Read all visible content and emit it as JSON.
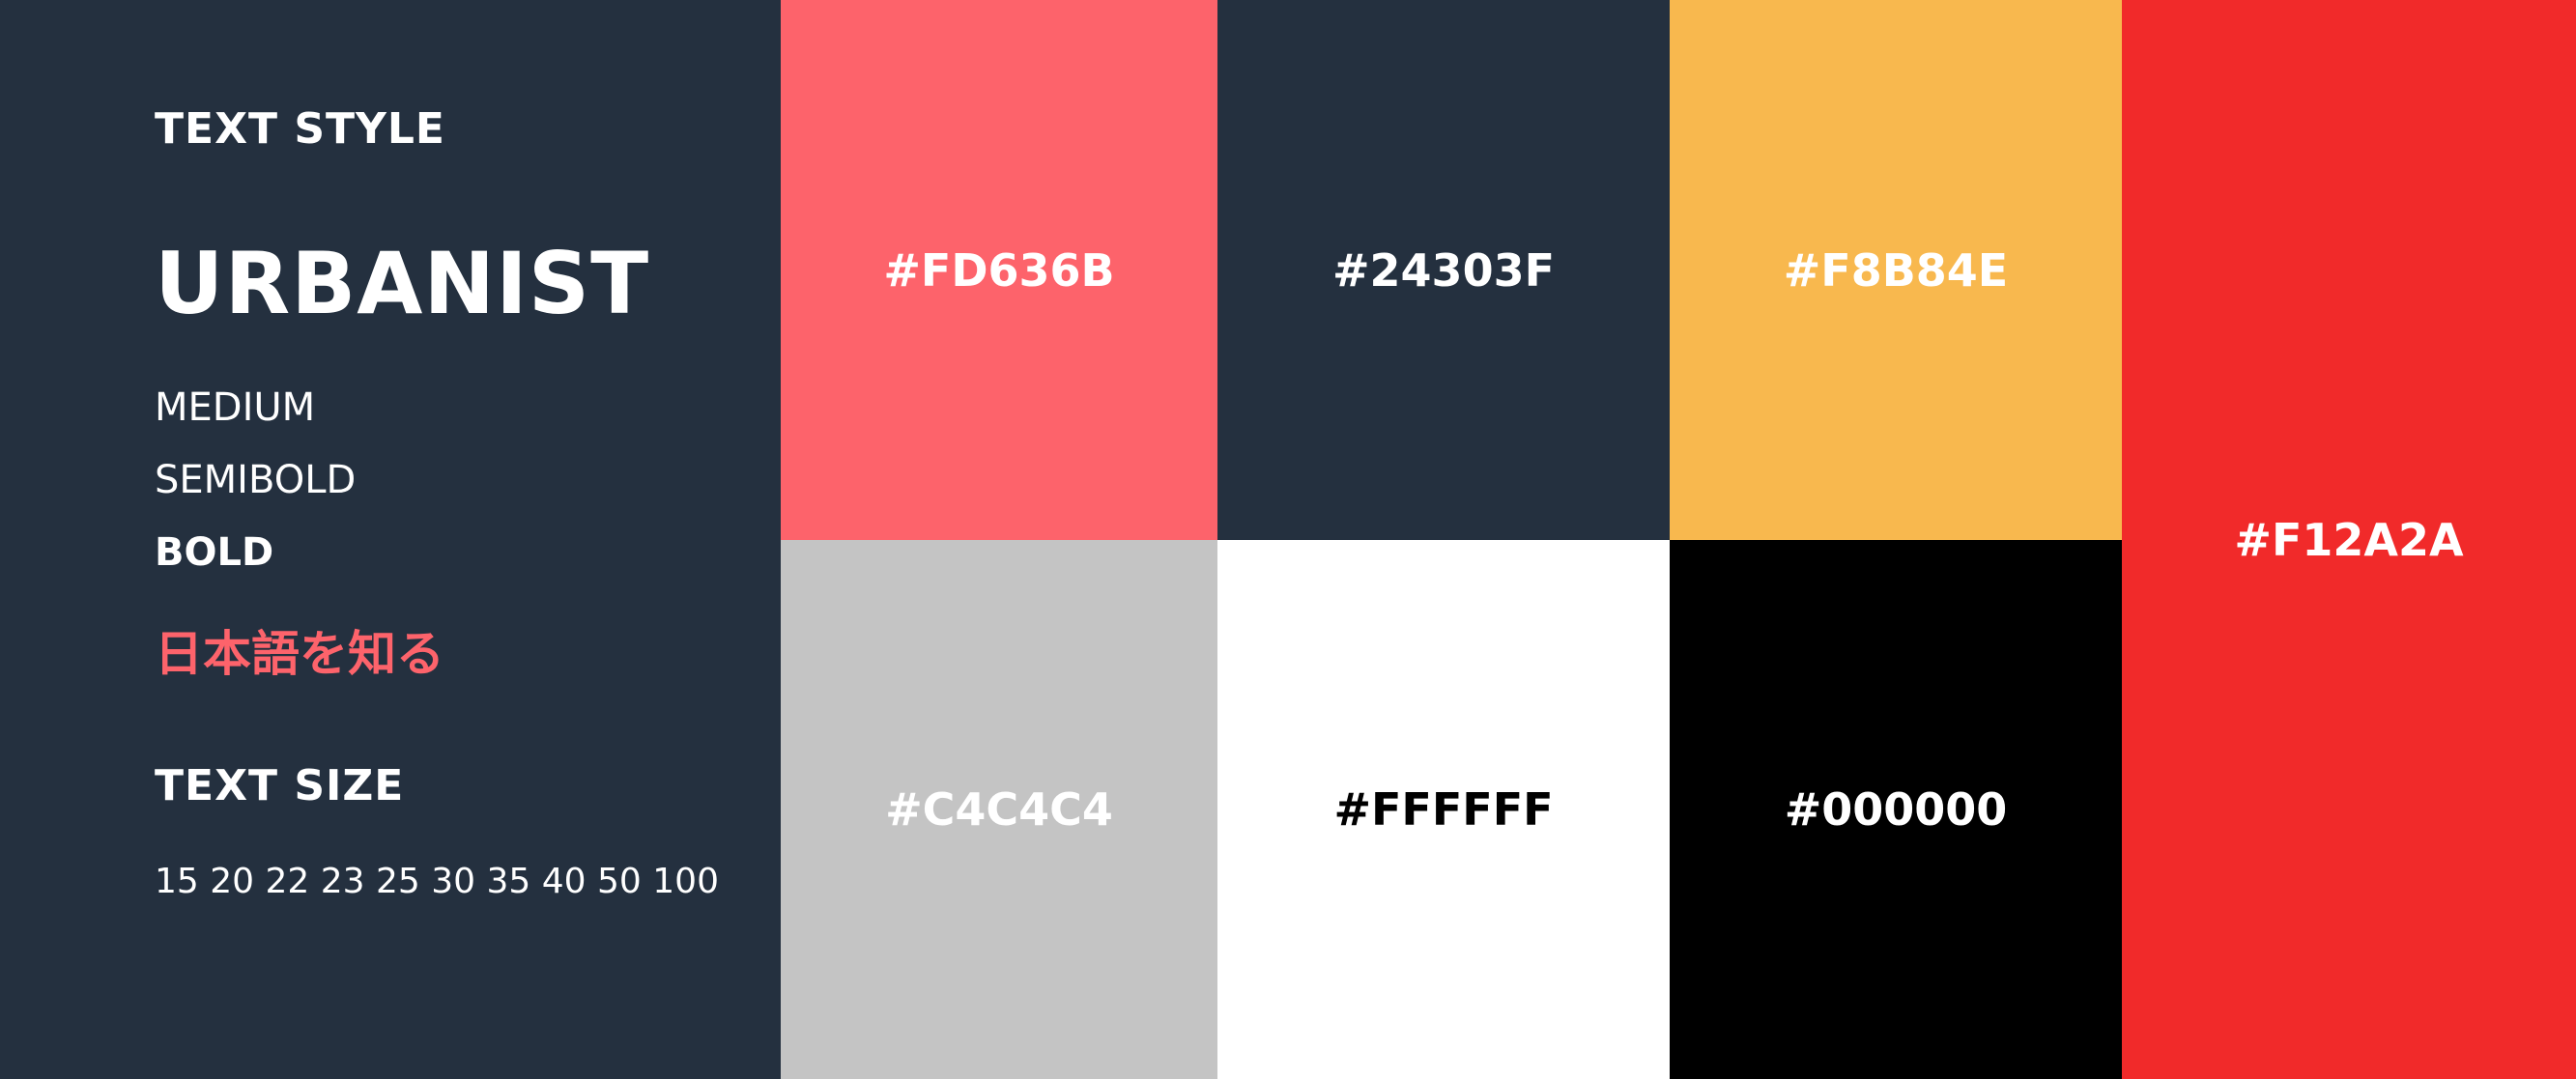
{
  "typography": {
    "style_heading": "TEXT STYLE",
    "font_name": "URBANIST",
    "weights": [
      "MEDIUM",
      "SEMIBOLD",
      "BOLD"
    ],
    "japanese_sample": "日本語を知る",
    "size_heading": "TEXT SIZE",
    "sizes": "15 20 22 23 25 30 35 40 50 100"
  },
  "colors": {
    "panel_background": "#24303F",
    "panel_text": "#FFFFFF",
    "japanese_text": "#FD636B"
  },
  "swatches": [
    {
      "hex": "#FD636B",
      "background": "#FD636B",
      "label_color": "#FFFFFF"
    },
    {
      "hex": "#24303F",
      "background": "#24303F",
      "label_color": "#FFFFFF"
    },
    {
      "hex": "#F8B84E",
      "background": "#F8B84E",
      "label_color": "#FFFFFF"
    },
    {
      "hex": "#F12A2A",
      "background": "#F12A2A",
      "label_color": "#FFFFFF"
    },
    {
      "hex": "#C4C4C4",
      "background": "#C4C4C4",
      "label_color": "#FFFFFF"
    },
    {
      "hex": "#FFFFFF",
      "background": "#FFFFFF",
      "label_color": "#000000"
    },
    {
      "hex": "#000000",
      "background": "#000000",
      "label_color": "#FFFFFF"
    }
  ]
}
